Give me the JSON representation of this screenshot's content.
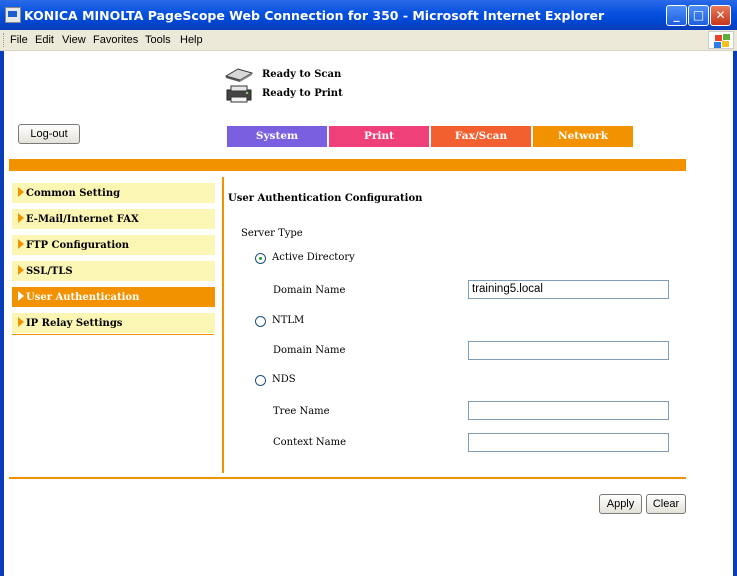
{
  "window": {
    "title": "KONICA MINOLTA PageScope Web Connection for 350 - Microsoft Internet Explorer"
  },
  "menu": [
    "File",
    "Edit",
    "View",
    "Favorites",
    "Tools",
    "Help"
  ],
  "status": {
    "scan": "Ready to Scan",
    "print": "Ready to Print"
  },
  "logout_label": "Log-out",
  "tabs": [
    {
      "label": "System",
      "color": "#7a5fe0"
    },
    {
      "label": "Print",
      "color": "#f0407a"
    },
    {
      "label": "Fax/Scan",
      "color": "#f36030"
    },
    {
      "label": "Network",
      "color": "#f39200"
    }
  ],
  "sidebar": {
    "items": [
      {
        "label": "Common Setting"
      },
      {
        "label": "E-Mail/Internet FAX"
      },
      {
        "label": "FTP Configuration"
      },
      {
        "label": "SSL/TLS"
      },
      {
        "label": "User Authentication",
        "active": true
      },
      {
        "label": "IP Relay Settings"
      }
    ]
  },
  "form": {
    "heading": "User Authentication Configuration",
    "server_type_label": "Server Type",
    "active_directory": {
      "label": "Active Directory",
      "checked": true
    },
    "ad_domain_label": "Domain Name",
    "ad_domain_value": "training5.local",
    "ntlm": {
      "label": "NTLM",
      "checked": false
    },
    "ntlm_domain_label": "Domain Name",
    "ntlm_domain_value": "",
    "nds": {
      "label": "NDS",
      "checked": false
    },
    "tree_name_label": "Tree Name",
    "tree_name_value": "",
    "context_name_label": "Context Name",
    "context_name_value": ""
  },
  "buttons": {
    "apply": "Apply",
    "clear": "Clear"
  },
  "colors": {
    "accent_orange": "#f39200",
    "sidebar_bg": "#fcf6b4",
    "titlebar_blue": "#0a53e0"
  }
}
